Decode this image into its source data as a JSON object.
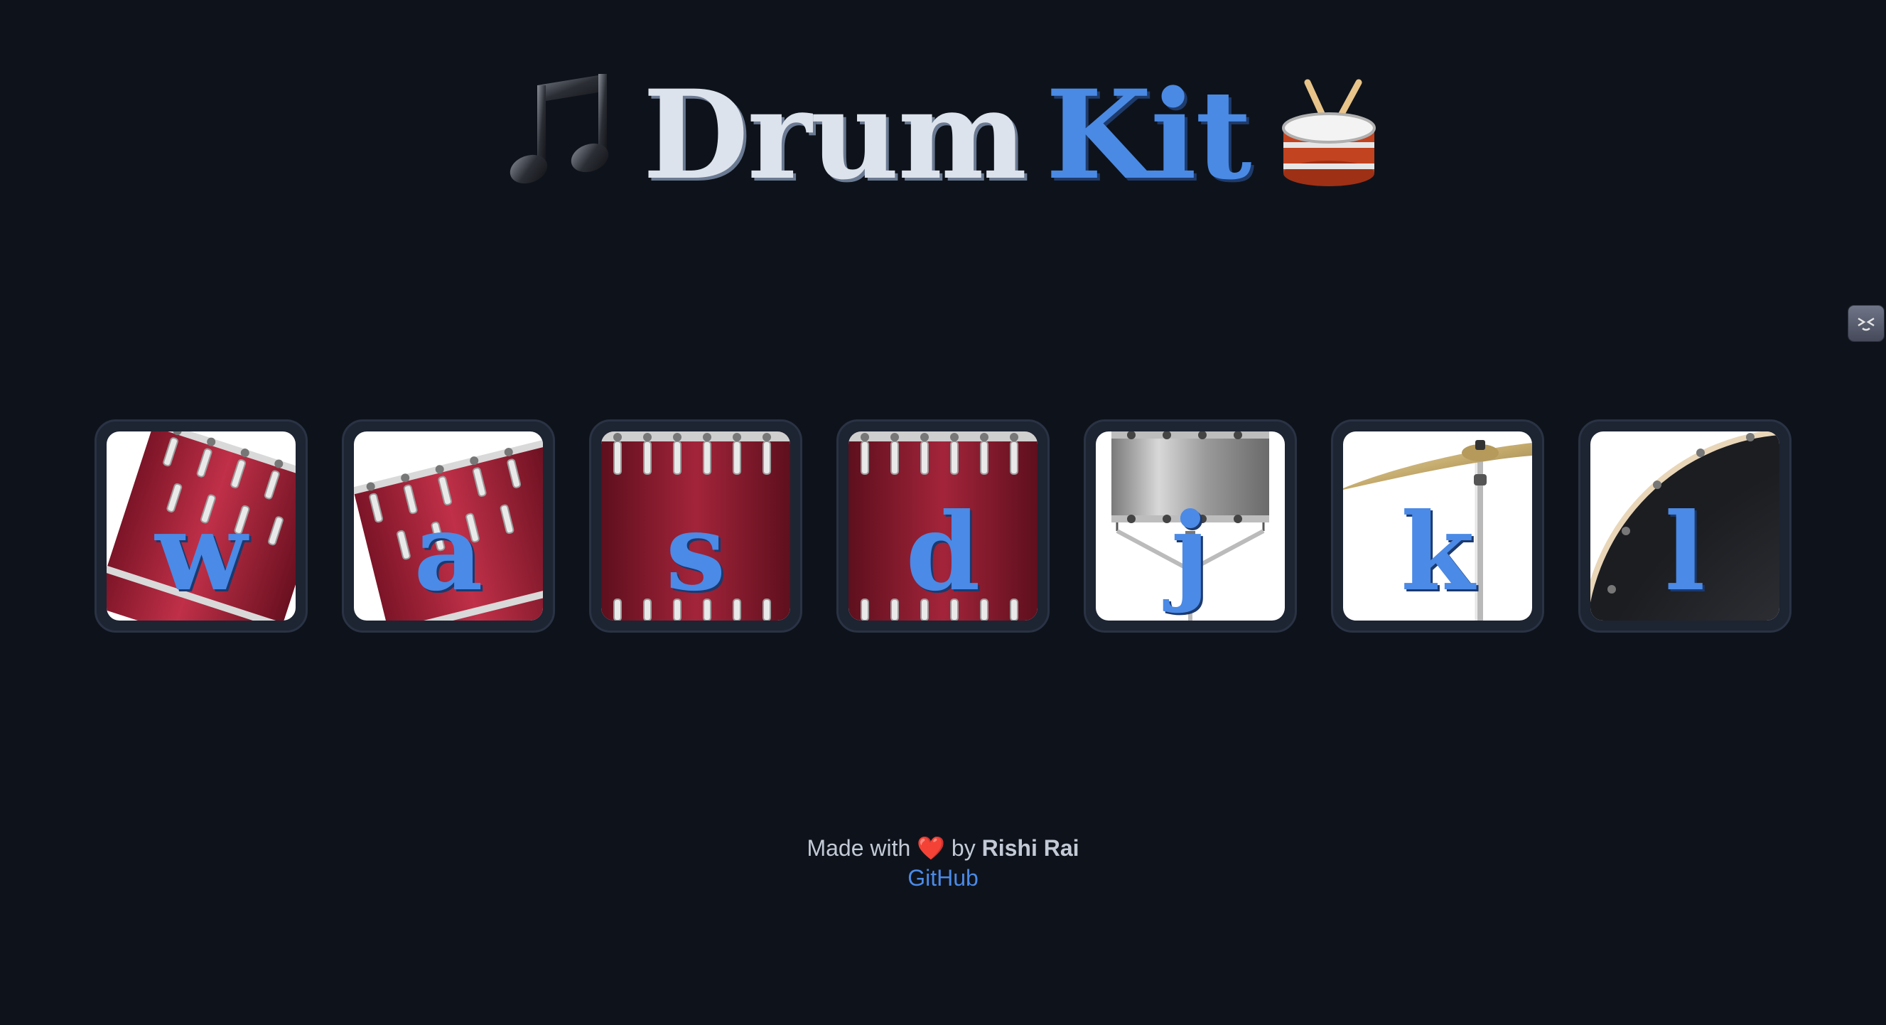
{
  "header": {
    "title_word1": "Drum",
    "title_word2": "Kit",
    "left_icon": "musical-notes-icon",
    "right_icon": "drum-icon"
  },
  "side_widget": {
    "icon": "extension-icon"
  },
  "keys": [
    {
      "letter": "w",
      "image": "tom-tom-drum-icon"
    },
    {
      "letter": "a",
      "image": "tom-tom-drum-icon"
    },
    {
      "letter": "s",
      "image": "bass-drum-icon"
    },
    {
      "letter": "d",
      "image": "bass-drum-icon"
    },
    {
      "letter": "j",
      "image": "snare-drum-icon"
    },
    {
      "letter": "k",
      "image": "cymbal-icon"
    },
    {
      "letter": "l",
      "image": "kick-drum-icon"
    }
  ],
  "footer": {
    "prefix": "Made with",
    "heart": "❤️",
    "by": "by",
    "author": "Rishi Rai",
    "link_label": "GitHub"
  },
  "colors": {
    "background": "#0e131b",
    "accent": "#4a8ae4",
    "drum_red": "#9c1f35",
    "tile_border": "#2a3344"
  }
}
